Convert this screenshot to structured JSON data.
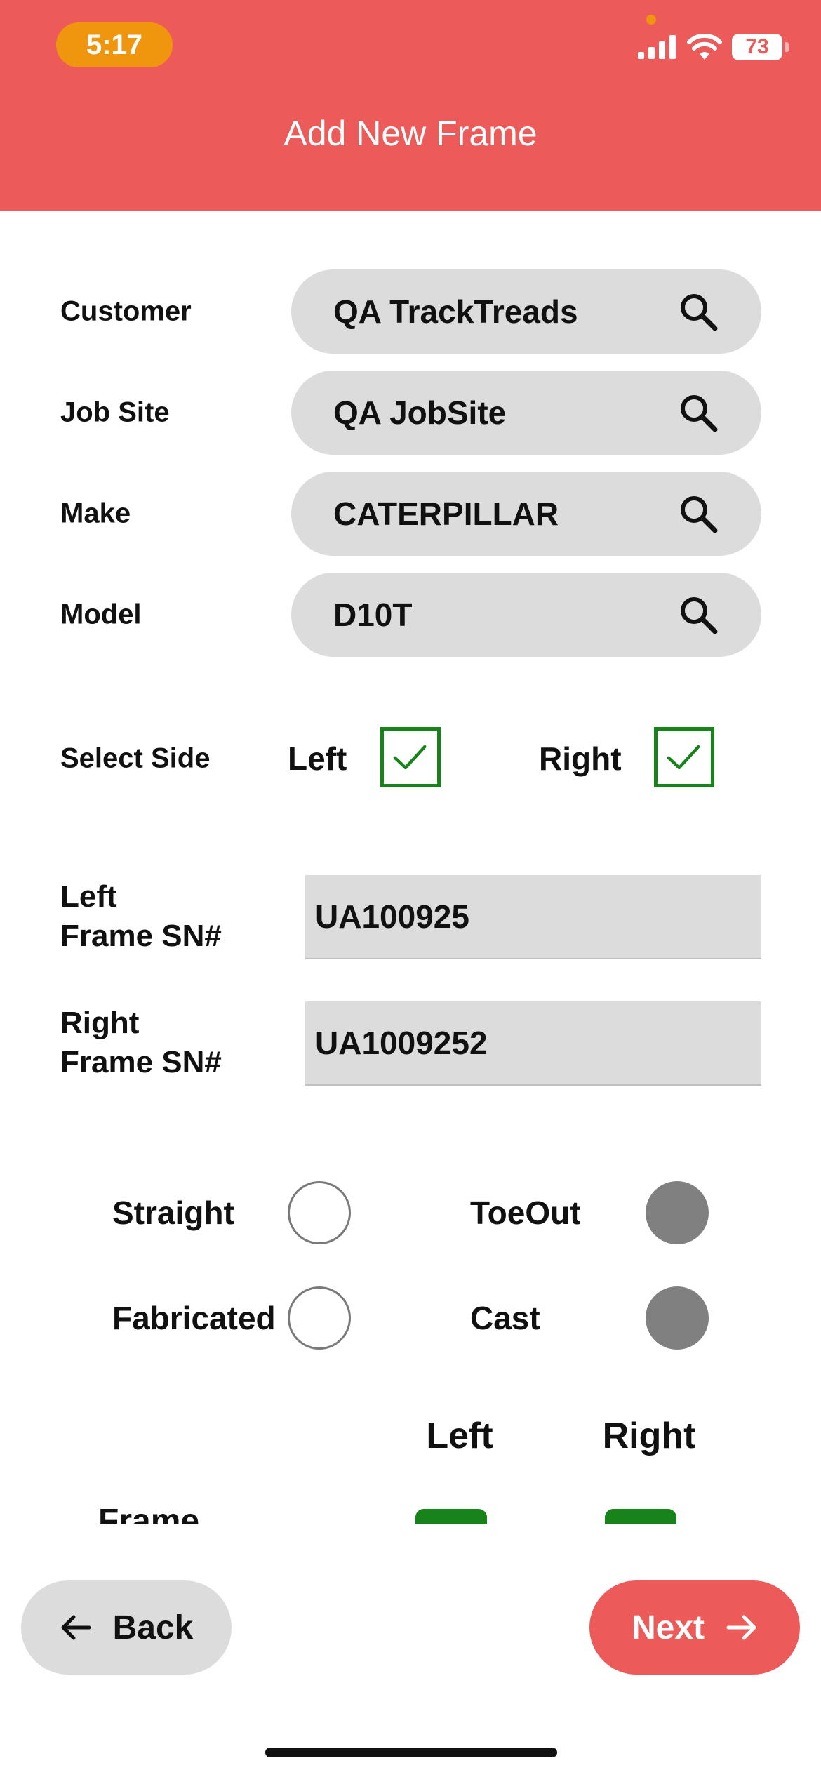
{
  "status_bar": {
    "time": "5:17",
    "battery": "73"
  },
  "header": {
    "title": "Add New Frame"
  },
  "form": {
    "fields": [
      {
        "label": "Customer",
        "value": "QA TrackTreads"
      },
      {
        "label": "Job Site",
        "value": "QA JobSite"
      },
      {
        "label": "Make",
        "value": "CATERPILLAR"
      },
      {
        "label": "Model",
        "value": "D10T"
      }
    ],
    "select_side": {
      "label": "Select Side",
      "left_label": "Left",
      "left_checked": true,
      "right_label": "Right",
      "right_checked": true
    },
    "serials": [
      {
        "label_line1": "Left",
        "label_line2": "Frame SN#",
        "value": "UA100925"
      },
      {
        "label_line1": "Right",
        "label_line2": "Frame SN#",
        "value": "UA1009252"
      }
    ],
    "frame_options": {
      "straight": {
        "label": "Straight",
        "selected": false
      },
      "toeout": {
        "label": "ToeOut",
        "selected": true
      },
      "fabricated": {
        "label": "Fabricated",
        "selected": false
      },
      "cast": {
        "label": "Cast",
        "selected": true
      }
    },
    "columns": {
      "left": "Left",
      "right": "Right"
    },
    "partial_row_label": "Frame"
  },
  "footer": {
    "back_label": "Back",
    "next_label": "Next"
  },
  "colors": {
    "accent": "#ec5a5a",
    "check_green": "#17831a",
    "pill_bg": "#dcdcdc"
  }
}
